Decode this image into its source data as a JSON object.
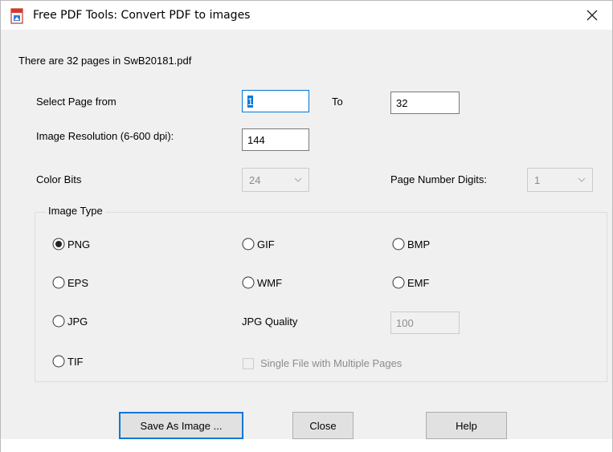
{
  "window": {
    "title": "Free PDF Tools: Convert PDF to images",
    "app_icon": "pdf-file-icon",
    "close_icon": "close-icon"
  },
  "info": {
    "page_count_text": "There are 32 pages in SwB20181.pdf"
  },
  "page_range": {
    "from_label": "Select Page from",
    "from_value": "1",
    "to_label": "To",
    "to_value": "32"
  },
  "resolution": {
    "label": "Image Resolution (6-600 dpi):",
    "value": "144"
  },
  "color_bits": {
    "label": "Color Bits",
    "value": "24"
  },
  "page_digits": {
    "label": "Page Number Digits:",
    "value": "1"
  },
  "image_type": {
    "legend": "Image Type",
    "options": [
      {
        "label": "PNG",
        "selected": true
      },
      {
        "label": "GIF",
        "selected": false
      },
      {
        "label": "BMP",
        "selected": false
      },
      {
        "label": "EPS",
        "selected": false
      },
      {
        "label": "WMF",
        "selected": false
      },
      {
        "label": "EMF",
        "selected": false
      },
      {
        "label": "JPG",
        "selected": false
      },
      {
        "label": "TIF",
        "selected": false
      }
    ],
    "jpg_quality_label": "JPG Quality",
    "jpg_quality_value": "100",
    "single_file_label": "Single File with Multiple Pages",
    "single_file_checked": false
  },
  "buttons": {
    "save": "Save As Image ...",
    "close": "Close",
    "help": "Help"
  },
  "colors": {
    "focus_border": "#0078d7",
    "window_bg": "#f0f0f0",
    "disabled_text": "#8c8c8c"
  }
}
